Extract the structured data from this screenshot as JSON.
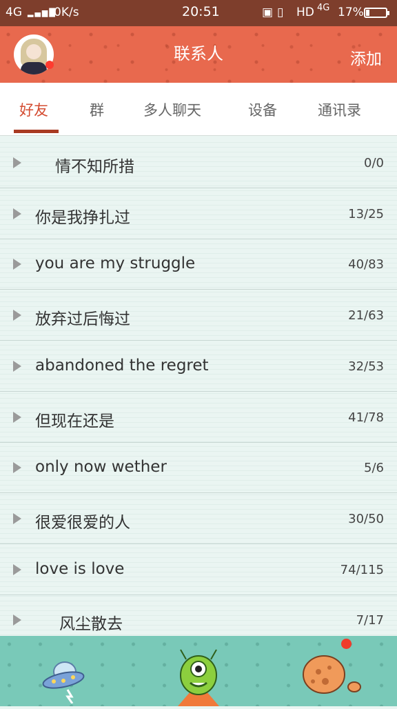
{
  "status_bar": {
    "network": "4G",
    "speed": "0K/s",
    "time": "20:51",
    "hd": "HD",
    "network2": "4G",
    "battery_text": "17%",
    "battery_level": 0.17
  },
  "header": {
    "title": "联系人",
    "add_label": "添加",
    "colors": {
      "header_bg": "#e8694e",
      "status_bg": "#7e3e2c",
      "accent": "#d44c31"
    }
  },
  "tabs": [
    {
      "label": "好友"
    },
    {
      "label": "群"
    },
    {
      "label": "多人聊天"
    },
    {
      "label": "设备"
    },
    {
      "label": "通讯录"
    }
  ],
  "groups": [
    {
      "name": "情不知所措",
      "count": "0/0"
    },
    {
      "name": "你是我挣扎过",
      "count": "13/25"
    },
    {
      "name": "you are my struggle",
      "count": "40/83"
    },
    {
      "name": "放弃过后悔过",
      "count": "21/63"
    },
    {
      "name": "abandoned the regret",
      "count": "32/53"
    },
    {
      "name": "但现在还是",
      "count": "41/78"
    },
    {
      "name": "only now wether",
      "count": "5/6"
    },
    {
      "name": "很爱很爱的人",
      "count": "30/50"
    },
    {
      "name": "love is love",
      "count": "74/115"
    },
    {
      "name": "风尘散去",
      "count": "7/17"
    }
  ],
  "bottom_nav": [
    {
      "icon": "ufo-icon"
    },
    {
      "icon": "alien-icon"
    },
    {
      "icon": "planet-icon"
    }
  ]
}
